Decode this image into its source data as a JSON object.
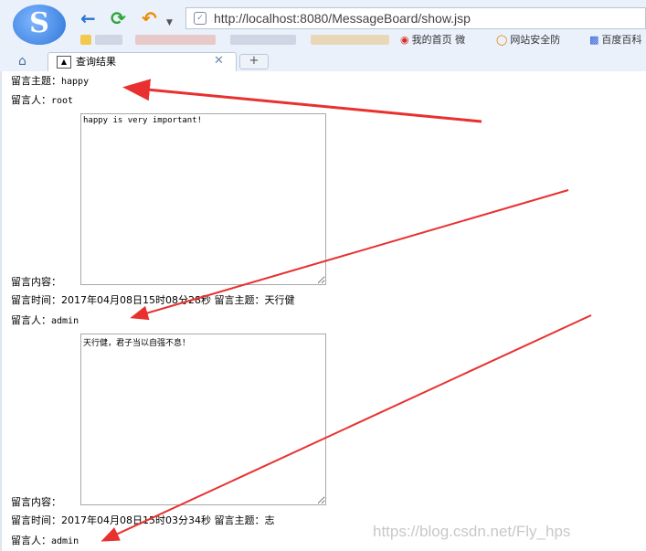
{
  "browser": {
    "logo_letter": "S",
    "url": "http://localhost:8080/MessageBoard/show.jsp",
    "bookmarks": [
      {
        "icon": "eye-icon",
        "label": "我的首页 微",
        "color": "#d92b2b"
      },
      {
        "icon": "shield-icon",
        "label": "网站安全防",
        "color": "#e07b00"
      },
      {
        "icon": "paw-icon",
        "label": "百度百科",
        "color": "#2a5bd7"
      }
    ],
    "tab": {
      "title": "查询结果"
    },
    "new_tab_label": "+"
  },
  "messages": [
    {
      "subject_label": "留言主题：",
      "subject": "happy",
      "author_label": "留言人：",
      "author": "root",
      "content_label": "留言内容：",
      "content": "happy is very important!",
      "time_label": "留言时间：",
      "time": "2017年04月08日15时08分28秒"
    },
    {
      "subject_label": "留言主题：",
      "subject": "天行健",
      "author_label": "留言人：",
      "author": "admin",
      "content_label": "留言内容：",
      "content": "天行健，君子当以自强不息！",
      "time_label": "留言时间：",
      "time": "2017年04月08日15时03分34秒"
    },
    {
      "subject_label": "留言主题：",
      "subject": "志",
      "author_label": "留言人：",
      "author": "admin"
    }
  ],
  "watermark": "https://blog.csdn.net/Fly_hps",
  "colors": {
    "arrow": "#e8312f",
    "chrome": "#eaf1fb"
  }
}
